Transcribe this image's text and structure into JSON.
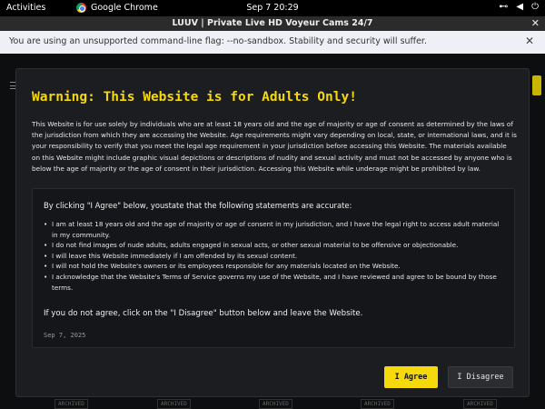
{
  "system_bar": {
    "activities": "Activities",
    "app_name": "Google Chrome",
    "clock": "Sep 7  20:29"
  },
  "window": {
    "title": "LUUV | Private Live HD Voyeur Cams 24/7"
  },
  "infobar": {
    "message": "You are using an unsupported command-line flag: --no-sandbox. Stability and security will suffer."
  },
  "background": {
    "archived_badges": [
      "ARCHIVED",
      "ARCHIVED",
      "ARCHIVED",
      "ARCHIVED",
      "ARCHIVED"
    ]
  },
  "modal": {
    "title": "Warning: This Website is for Adults Only!",
    "intro": "This Website is for use solely by individuals who are at least 18 years old and the age of majority or age of consent as determined by the laws of the jurisdiction from which they are accessing the Website. Age requirements might vary depending on local, state, or international laws, and it is your responsibility to verify that you meet the legal age requirement in your jurisdiction before accessing this Website. The materials available on this Website might include graphic visual depictions or descriptions of nudity and sexual activity and must not be accessed by anyone who is below the age of majority or the age of consent in their jurisdiction. Accessing this Website while underage might be prohibited by law.",
    "lead": "By clicking \"I Agree\" below, youstate that the following statements are accurate:",
    "statements": [
      "I am at least 18 years old and the age of majority or age of consent in my jurisdiction, and I have the legal right to access adult material in my community.",
      "I do not find images of nude adults, adults engaged in sexual acts, or other sexual material to be offensive or objectionable.",
      "I will leave this Website immediately if I am offended by its sexual content.",
      "I will not hold the Website's owners or its employees responsible for any materials located on the Website.",
      "I acknowledge that the Website's Terms of Service governs my use of the Website, and I have reviewed and agree to be bound by those terms."
    ],
    "leave_text": "If you do not agree, click on the \"I Disagree\" button below and leave the Website.",
    "date": "Sep 7, 2025",
    "agree_label": "I Agree",
    "disagree_label": "I Disagree"
  },
  "colors": {
    "accent": "#f5d90a",
    "modal_bg": "#1c1d20",
    "page_bg": "#0d0e10"
  }
}
